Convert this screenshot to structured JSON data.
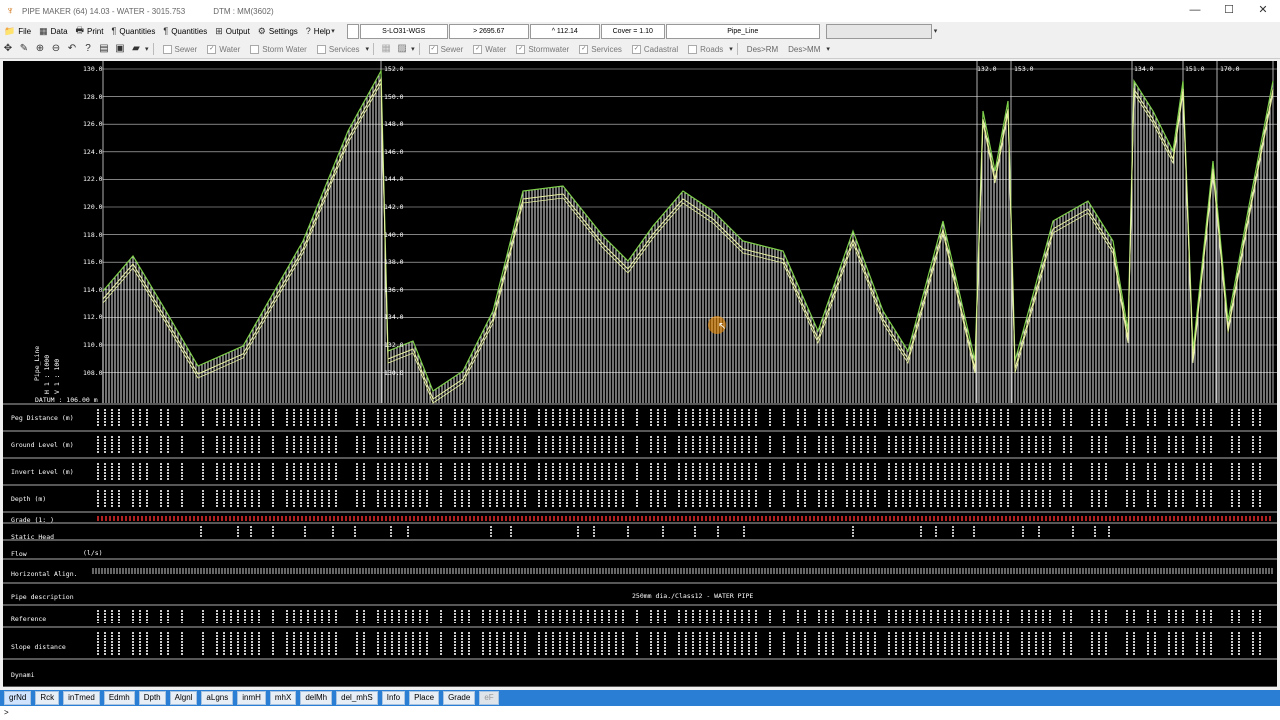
{
  "window": {
    "title": "PIPE MAKER (64) 14.03 - WATER - 3015.753",
    "dtm": "DTM : MM(3602)",
    "minimize": "—",
    "maximize": "☐",
    "close": "✕"
  },
  "menu": {
    "items": [
      {
        "label": "File",
        "icon": "📁"
      },
      {
        "label": "Data",
        "icon": "▦"
      },
      {
        "label": "Print",
        "icon": "🖶"
      },
      {
        "label": "Quantities",
        "icon": "¶"
      },
      {
        "label": "Quantities",
        "icon": "¶"
      },
      {
        "label": "Output",
        "icon": "⊞"
      },
      {
        "label": "Settings",
        "icon": "⚙"
      },
      {
        "label": "Help",
        "icon": "?"
      }
    ],
    "fields": {
      "coord_system": "S-LO31-WGS",
      "x_value": "> 2695.67",
      "y_value": "^ 112.14",
      "cover": "Cover = 1.10",
      "layer": "Pipe_Line"
    }
  },
  "toolbar": {
    "filters_a": [
      "Sewer",
      "Water",
      "Storm Water",
      "Services"
    ],
    "filters_b": [
      "Sewer",
      "Water",
      "Stormwater",
      "Services",
      "Cadastral",
      "Roads"
    ],
    "des_rm": "Des>RM",
    "des_mm": "Des>MM"
  },
  "profile": {
    "left_axis": [
      "130.0",
      "128.0",
      "126.0",
      "124.0",
      "122.0",
      "120.0",
      "118.0",
      "116.0",
      "114.0",
      "112.0",
      "110.0",
      "108.0"
    ],
    "right_axis_1": [
      "152.0",
      "150.0",
      "148.0",
      "146.0",
      "144.0",
      "142.0",
      "140.0",
      "138.0",
      "136.0",
      "134.0",
      "132.0",
      "130.0"
    ],
    "datum": "DATUM : 106.00 m",
    "scales": [
      "Pipe_Line",
      "H 1 : 1000",
      "V 1 : 100"
    ],
    "section_axes": [
      {
        "top": "132.0"
      },
      {
        "top": "153.0"
      },
      {
        "top": "134.0"
      },
      {
        "top": "151.0"
      },
      {
        "top": "170.0"
      }
    ]
  },
  "rows": [
    {
      "label": "Peg Distance (m)"
    },
    {
      "label": "Ground Level (m)"
    },
    {
      "label": "Invert Level (m)"
    },
    {
      "label": "Depth (m)"
    },
    {
      "label": "Grade (1:_)"
    },
    {
      "label": "Static Head"
    },
    {
      "label": "Flow"
    },
    {
      "label": "Horizontal Align."
    },
    {
      "label": "Pipe description"
    },
    {
      "label": "Reference"
    },
    {
      "label": "Slope distance"
    },
    {
      "label": "Dynami"
    }
  ],
  "flow_unit": "(l/s)",
  "pipe_description": "250mm dia./Class12 - WATER PIPE",
  "commands": [
    {
      "label": "grNd",
      "state": "active"
    },
    {
      "label": "Rck",
      "state": "normal"
    },
    {
      "label": "inTmed",
      "state": "normal"
    },
    {
      "label": "Edmh",
      "state": "normal"
    },
    {
      "label": "Dpth",
      "state": "normal"
    },
    {
      "label": "Algnl",
      "state": "normal"
    },
    {
      "label": "aLgns",
      "state": "normal"
    },
    {
      "label": "inmH",
      "state": "normal"
    },
    {
      "label": "mhX",
      "state": "normal"
    },
    {
      "label": "delMh",
      "state": "normal"
    },
    {
      "label": "del_mhS",
      "state": "normal"
    },
    {
      "label": "Info",
      "state": "normal"
    },
    {
      "label": "Place",
      "state": "normal"
    },
    {
      "label": "Grade",
      "state": "normal"
    },
    {
      "label": "eF",
      "state": "disabled"
    }
  ],
  "command_line": ">",
  "colors": {
    "canvas": "#000000",
    "profile_line": "#e8f0a0",
    "ground_line": "#7fd04b",
    "grade_text": "#ff3030",
    "command_bar": "#2a7fd4"
  }
}
